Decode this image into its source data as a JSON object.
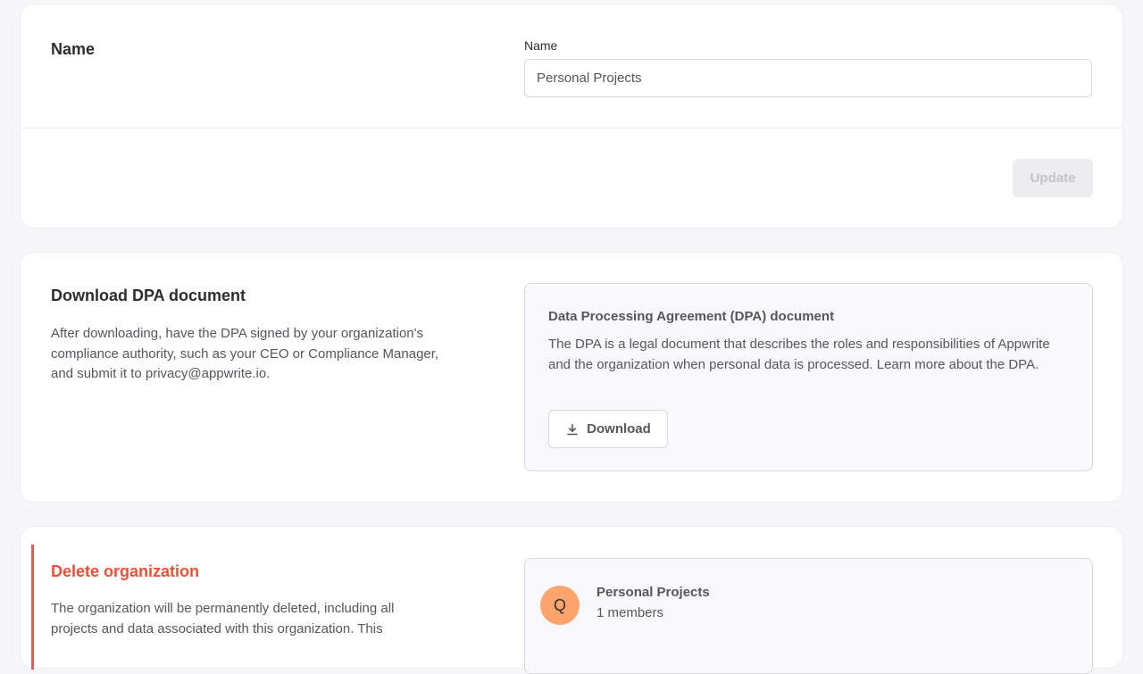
{
  "name_section": {
    "title": "Name",
    "field_label": "Name",
    "field_value": "Personal Projects",
    "update_label": "Update"
  },
  "dpa_section": {
    "title": "Download DPA document",
    "description": "After downloading, have the DPA signed by your organization's compliance authority, such as your CEO or Compliance Manager, and submit it to privacy@appwrite.io.",
    "box_title": "Data Processing Agreement (DPA) document",
    "box_description": "The DPA is a legal document that describes the roles and responsibilities of Appwrite and the organization when personal data is processed. Learn more about the DPA.",
    "download_label": "Download",
    "download_icon": "download-icon"
  },
  "delete_section": {
    "title": "Delete organization",
    "description": "The organization will be permanently deleted, including all projects and data associated with this organization. This",
    "org": {
      "avatar_letter": "Q",
      "name": "Personal Projects",
      "members": "1 members"
    }
  },
  "colors": {
    "danger": "#f04e37",
    "avatar": "#fea56d",
    "disabled_button": "#ededf0"
  }
}
